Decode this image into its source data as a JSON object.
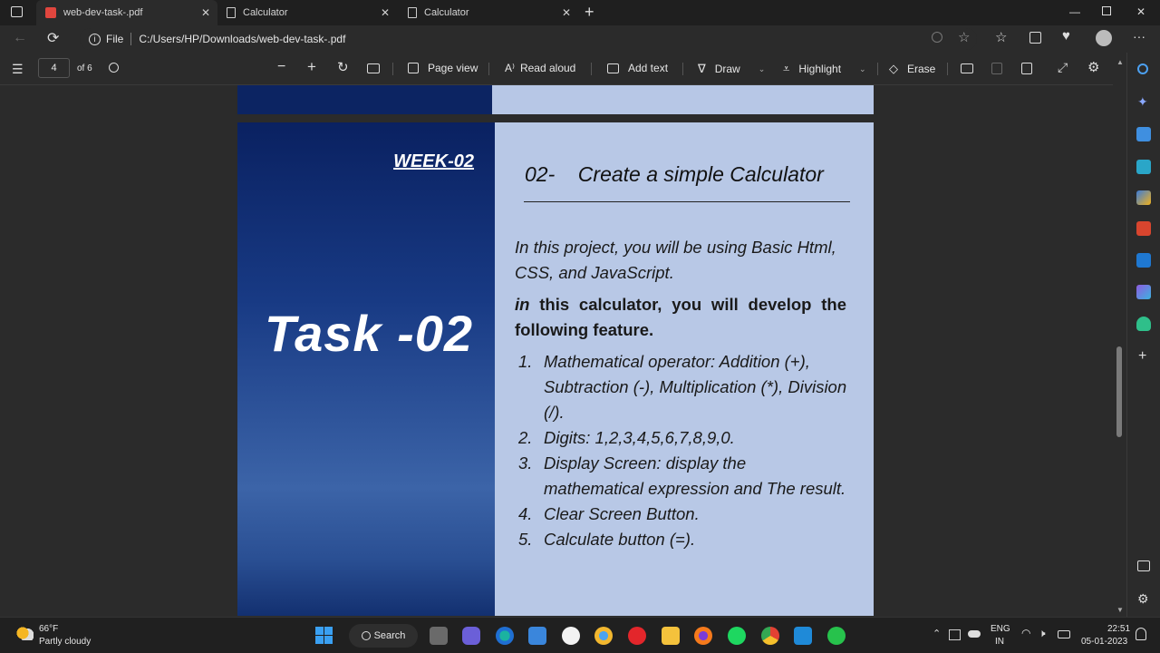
{
  "tabs": [
    {
      "label": "web-dev-task-.pdf",
      "active": true
    },
    {
      "label": "Calculator",
      "active": false
    },
    {
      "label": "Calculator",
      "active": false
    }
  ],
  "address": {
    "prefix": "File",
    "url": "C:/Users/HP/Downloads/web-dev-task-.pdf"
  },
  "pdf_toolbar": {
    "page_number": "4",
    "page_total": "of 6",
    "page_view": "Page view",
    "read_aloud": "Read aloud",
    "add_text": "Add text",
    "draw": "Draw",
    "highlight": "Highlight",
    "erase": "Erase"
  },
  "document": {
    "week": "WEEK-02",
    "task": "Task -02",
    "heading": "02-    Create a simple Calculator",
    "intro": "In this project, you will be using Basic Html, CSS, and JavaScript.",
    "para_lead": "in",
    "para_rest": " this calculator, you will develop the following feature.",
    "list": [
      {
        "n": "1.",
        "t": "Mathematical operator: Addition (+), Subtraction (-), Multiplication (*), Division (/)."
      },
      {
        "n": "2.",
        "t": "Digits: 1,2,3,4,5,6,7,8,9,0."
      },
      {
        "n": "3.",
        "t": "Display Screen: display the mathematical expression and The result."
      },
      {
        "n": "4.",
        "t": "Clear Screen Button."
      },
      {
        "n": "5.",
        "t": "Calculate button (=)."
      }
    ]
  },
  "taskbar": {
    "weather_temp": "66°F",
    "weather_desc": "Partly cloudy",
    "search": "Search",
    "lang1": "ENG",
    "lang2": "IN",
    "time": "22:51",
    "date": "05-01-2023"
  }
}
